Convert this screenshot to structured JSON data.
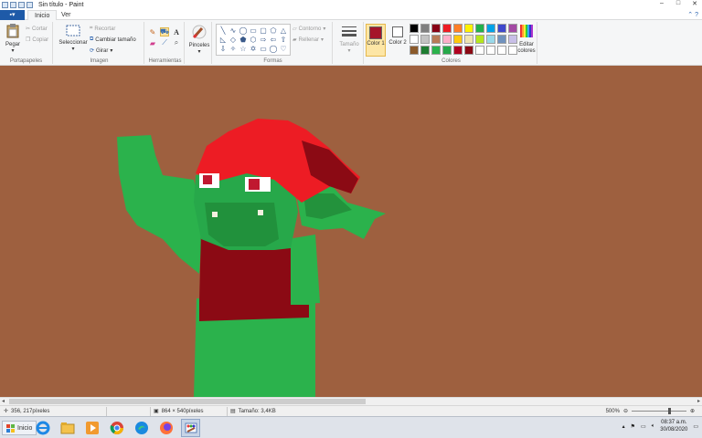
{
  "window": {
    "title": "Sin título - Paint",
    "controls": [
      "–",
      "□",
      "✕"
    ]
  },
  "tabs": {
    "file_icon": "file-menu",
    "items": [
      {
        "label": "Inicio",
        "active": true
      },
      {
        "label": "Ver",
        "active": false
      }
    ]
  },
  "ribbon": {
    "portapapeles": {
      "label": "Portapapeles",
      "paste": "Pegar",
      "cut": "Cortar",
      "copy": "Copiar"
    },
    "imagen": {
      "label": "Imagen",
      "select": "Seleccionar",
      "crop": "Recortar",
      "resize": "Cambiar tamaño",
      "rotate": "Girar"
    },
    "herramientas": {
      "label": "Herramientas"
    },
    "pinceles": {
      "label": "Pinceles"
    },
    "formas": {
      "label": "Formas",
      "outline": "Contorno",
      "fill": "Rellenar"
    },
    "tamano": {
      "label": "Tamaño"
    },
    "colores": {
      "label": "Colores",
      "color1": "Color 1",
      "color2": "Color 2",
      "color1_value": "#a5152a",
      "color2_value": "#ffffff",
      "edit": "Editar colores",
      "palette": [
        "#000000",
        "#7f7f7f",
        "#880015",
        "#ed1c24",
        "#ff7f27",
        "#fff200",
        "#22b14c",
        "#00a2e8",
        "#3f48cc",
        "#a349a4",
        "#ffffff",
        "#c3c3c3",
        "#b97a57",
        "#ffaec9",
        "#ffc90e",
        "#efe4b0",
        "#b5e61d",
        "#99d9ea",
        "#7092be",
        "#c8bfe7",
        "#8b5a2b",
        "#1e7d32",
        "#2bb24c",
        "#27a84a",
        "#b00020",
        "#8b0a14",
        "#ffffff",
        "#ffffff",
        "#ffffff",
        "#ffffff"
      ]
    }
  },
  "canvas": {
    "background": "#9e603f"
  },
  "status": {
    "cursor": "356, 217píxeles",
    "dimensions": "864 × 540píxeles",
    "size": "Tamaño: 3,4KB",
    "zoom": "500%",
    "zoom_level_percent": 500
  },
  "taskbar": {
    "start": "Inicio",
    "apps": [
      "internet-explorer",
      "file-explorer",
      "media-player",
      "chrome",
      "edge",
      "firefox",
      "paint"
    ],
    "active_app": "paint",
    "time": "08:37 a.m.",
    "date": "30/08/2020"
  }
}
